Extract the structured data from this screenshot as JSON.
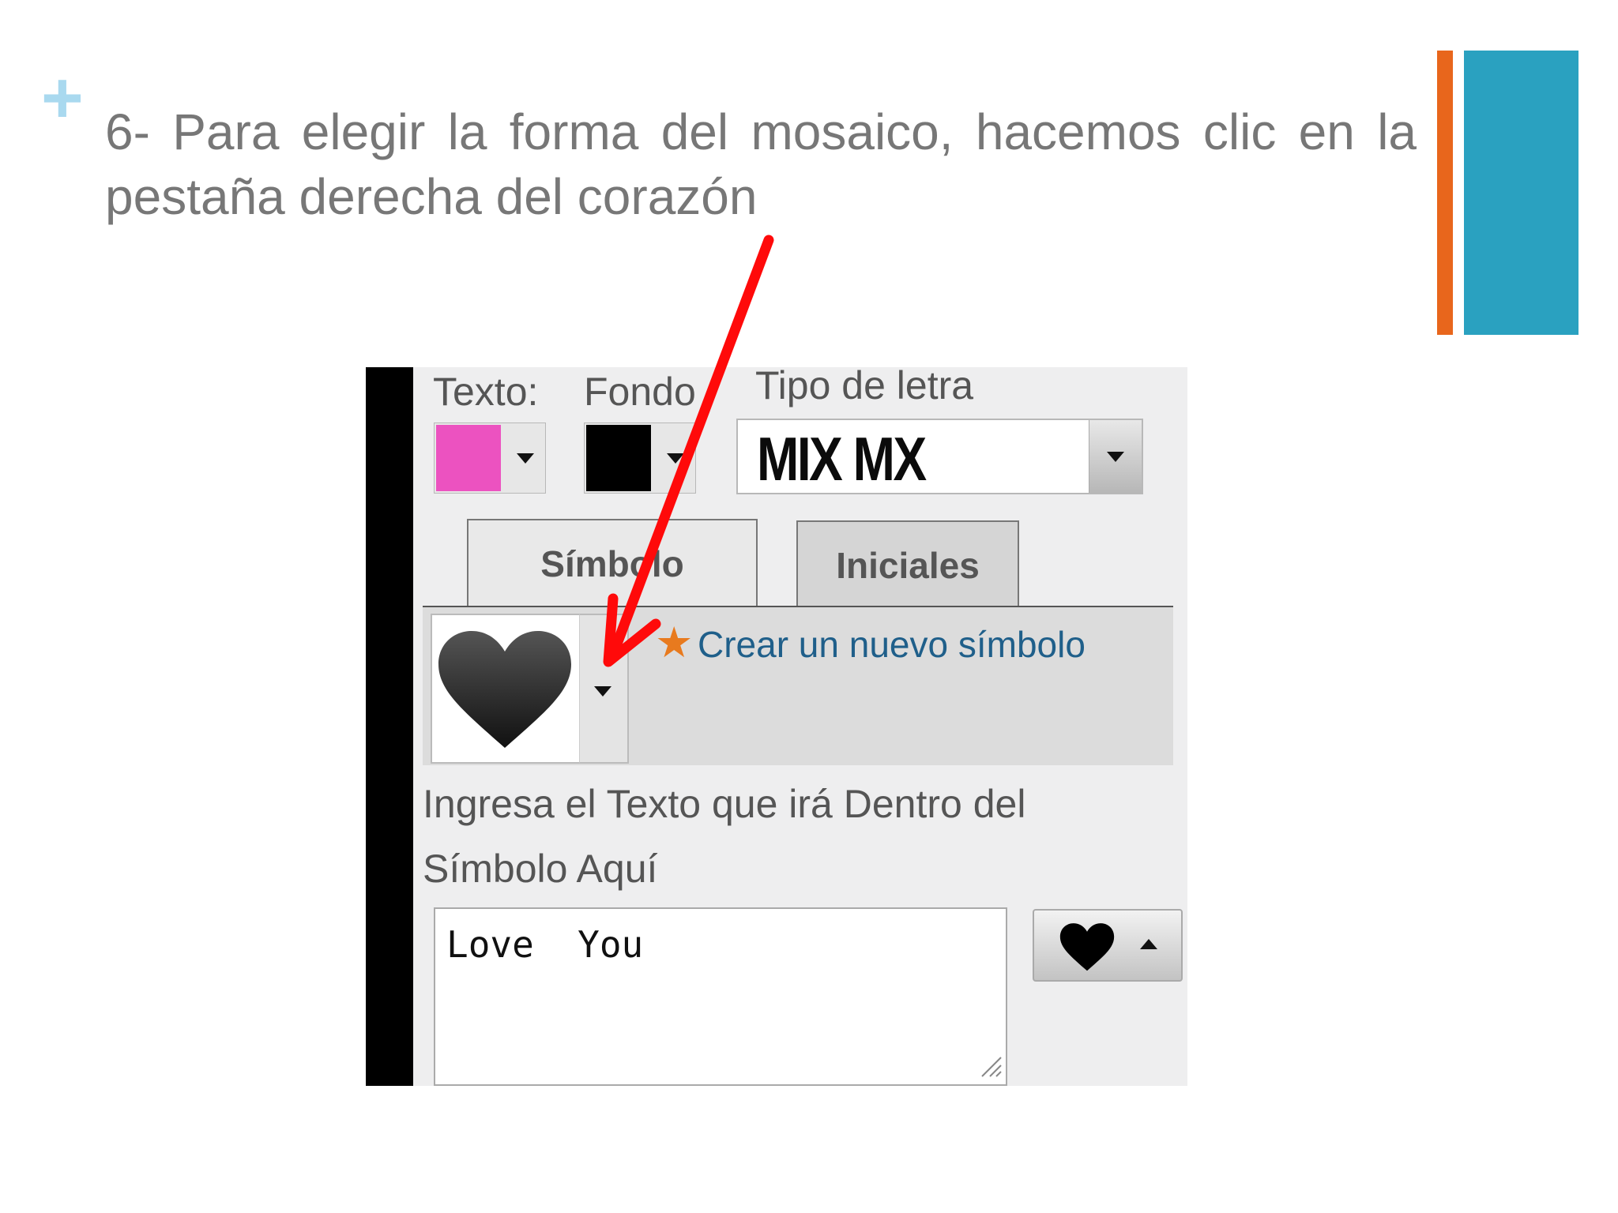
{
  "slide": {
    "plus_glyph": "+",
    "caption": "6- Para elegir la forma del mosaico, hacemos clic en la pestaña derecha del corazón",
    "colors": {
      "orange_bar": "#e8661c",
      "blue_bar": "#2aa1c0",
      "plus": "#a9d9ef",
      "arrow": "#ff0000"
    }
  },
  "app": {
    "text_color_label": "Texto:",
    "text_color_value": "#ec52c0",
    "background_label": "Fondo",
    "background_value": "#000000",
    "font_label": "Tipo de letra",
    "font_value": "MIX MX",
    "tabs": [
      {
        "label": "Símbolo",
        "active": true
      },
      {
        "label": "Iniciales",
        "active": false
      }
    ],
    "selected_symbol": "heart-icon",
    "new_symbol_link": "Crear un nuevo símbolo",
    "instruction": "Ingresa el Texto que irá Dentro del Símbolo Aquí",
    "text_input_value": "Love  You",
    "mini_symbol": "heart-icon"
  }
}
